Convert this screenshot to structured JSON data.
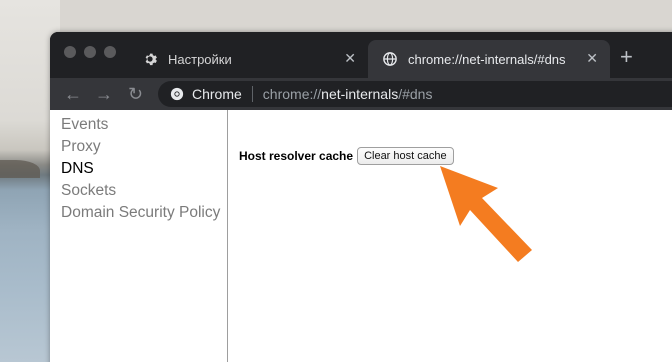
{
  "browser": {
    "tabs": [
      {
        "label": "Настройки",
        "icon": "gear-icon",
        "active": false
      },
      {
        "label": "chrome://net-internals/#dns",
        "icon": "globe-icon",
        "active": true
      }
    ],
    "close_glyph": "✕",
    "new_tab_glyph": "+",
    "omnibox": {
      "site_name": "Chrome",
      "url_prefix": "chrome://",
      "url_host": "net-internals",
      "url_suffix": "/#dns"
    },
    "nav": {
      "back": "←",
      "forward": "→",
      "reload": "↻"
    }
  },
  "sidebar": {
    "items": [
      {
        "label": "Events"
      },
      {
        "label": "Proxy"
      },
      {
        "label": "DNS",
        "selected": true
      },
      {
        "label": "Sockets"
      },
      {
        "label": "Domain Security Policy"
      }
    ]
  },
  "dns": {
    "label": "Host resolver cache",
    "clear_button": "Clear host cache"
  },
  "colors": {
    "annotation_arrow": "#f47c20",
    "tab_active_bg": "#35363a",
    "frame_bg": "#202124"
  }
}
